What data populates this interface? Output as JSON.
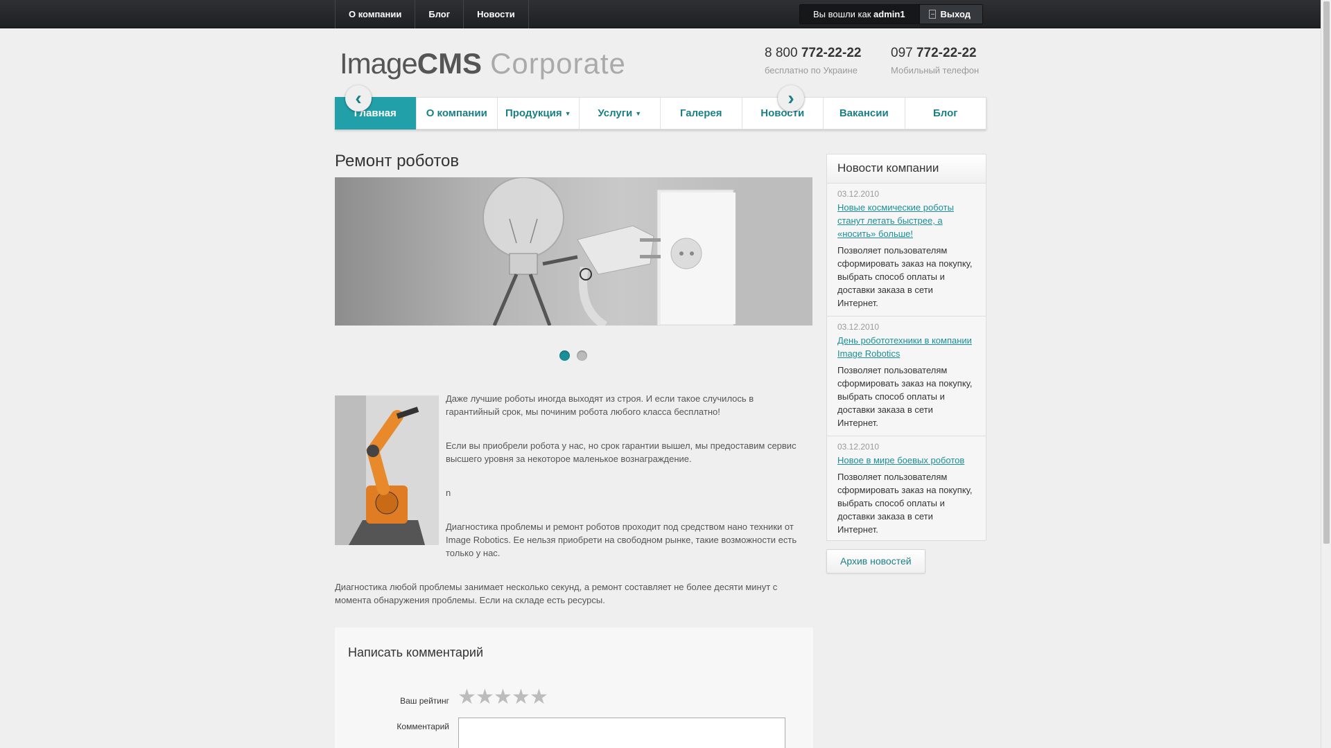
{
  "topbar": {
    "nav": [
      "О компании",
      "Блог",
      "Новости"
    ],
    "user_prefix": "Вы вошли как",
    "username": "admin1",
    "logout_label": "Выход"
  },
  "header": {
    "logo": {
      "image": "Image",
      "cms": "CMS",
      "corporate": "Corporate"
    },
    "phones": [
      {
        "prefix": "8 800",
        "number": "772-22-22",
        "caption": "бесплатно по Украине"
      },
      {
        "prefix": "097",
        "number": "772-22-22",
        "caption": "Мобильный телефон"
      }
    ]
  },
  "mainnav": {
    "items": [
      {
        "label": "Главная",
        "active": true,
        "dropdown": false
      },
      {
        "label": "О компании",
        "active": false,
        "dropdown": false
      },
      {
        "label": "Продукция",
        "active": false,
        "dropdown": true
      },
      {
        "label": "Услуги",
        "active": false,
        "dropdown": true
      },
      {
        "label": "Галерея",
        "active": false,
        "dropdown": false
      },
      {
        "label": "Новости",
        "active": false,
        "dropdown": false
      },
      {
        "label": "Вакансии",
        "active": false,
        "dropdown": false
      },
      {
        "label": "Блог",
        "active": false,
        "dropdown": false
      }
    ],
    "dropdown_glyph": "▼"
  },
  "page": {
    "title": "Ремонт роботов",
    "slider": {
      "prev": "‹",
      "next": "›",
      "slide_count": 2,
      "active_slide": 1
    },
    "paragraphs": [
      "Даже лучшие роботы иногда выходят из строя.  И если такое случилось в гарантийный срок, мы починим робота любого класса бесплатно!",
      "Если вы приобрели робота у нас, но срок гарантии вышел, мы предоставим сервис высшего уровня за некоторое маленькое вознаграждение.",
      "n",
      "Диагностика проблемы и ремонт роботов  проходит под средством нано техники от Image Robotics. Ее нельзя приобрети на свободном рынке, такие возможности есть только у нас."
    ],
    "footer_paragraph": "Диагностика любой проблемы занимает несколько секунд, а ремонт составляет не более десяти минут с момента обнаружения проблемы. Если на складе есть ресурсы."
  },
  "comment": {
    "title": "Написать комментарий",
    "rating_label": "Ваш рейтинг",
    "comment_label": "Комментарий",
    "star_glyph": "★",
    "rating_value": 0,
    "rating_max": 5
  },
  "sidebar": {
    "title": "Новости компании",
    "news": [
      {
        "date": "03.12.2010",
        "title": "Новые космические роботы станут летать быстрее, а «носить» больше!",
        "text": "Позволяет пользователям сформировать заказ на покупку, выбрать способ оплаты и доставки заказа в сети Интернет."
      },
      {
        "date": "03.12.2010",
        "title": "День робототехники в компании Image Robotics",
        "text": "Позволяет пользователям сформировать заказ на покупку, выбрать способ оплаты и доставки заказа в сети Интернет."
      },
      {
        "date": "03.12.2010",
        "title": "Новое в мире боевых роботов",
        "text": "Позволяет пользователям сформировать заказ на покупку, выбрать способ оплаты и доставки заказа в сети Интернет."
      }
    ],
    "archive_label": "Архив новостей"
  },
  "colors": {
    "accent": "#21a0a9",
    "link": "#1a8f98",
    "topbar": "#1e2023"
  }
}
